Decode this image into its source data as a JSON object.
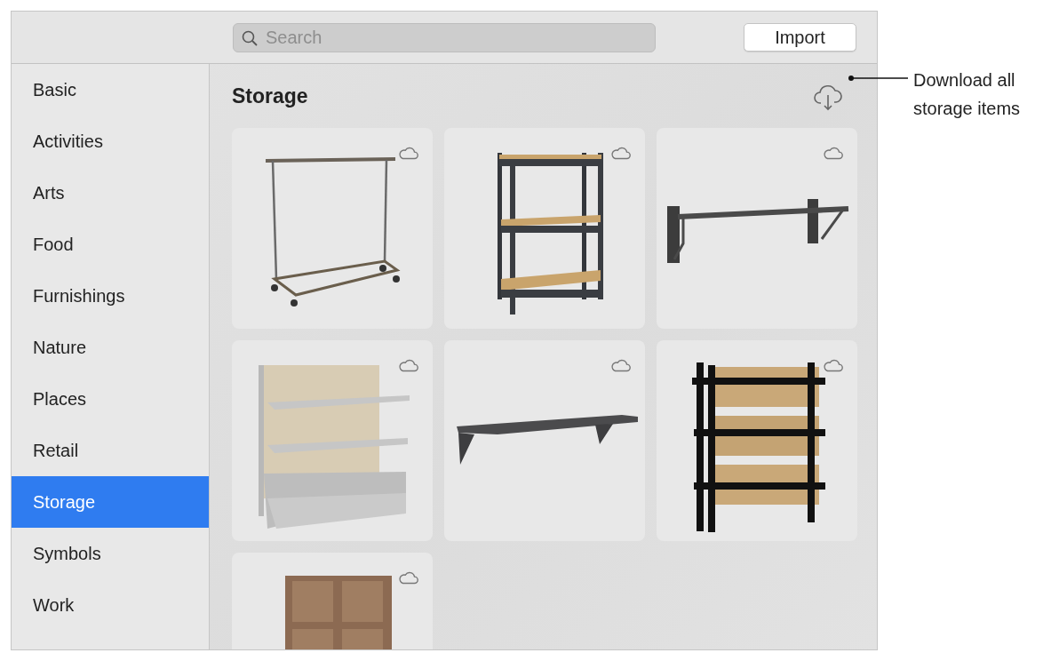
{
  "toolbar": {
    "search": {
      "placeholder": "Search"
    },
    "import_button": "Import"
  },
  "sidebar": {
    "items": [
      {
        "label": "Basic",
        "selected": false
      },
      {
        "label": "Activities",
        "selected": false
      },
      {
        "label": "Arts",
        "selected": false
      },
      {
        "label": "Food",
        "selected": false
      },
      {
        "label": "Furnishings",
        "selected": false
      },
      {
        "label": "Nature",
        "selected": false
      },
      {
        "label": "Places",
        "selected": false
      },
      {
        "label": "Retail",
        "selected": false
      },
      {
        "label": "Storage",
        "selected": true
      },
      {
        "label": "Symbols",
        "selected": false
      },
      {
        "label": "Work",
        "selected": false
      }
    ]
  },
  "content": {
    "title": "Storage",
    "items": [
      {
        "kind": "clothes-rack",
        "downloaded": false
      },
      {
        "kind": "metal-shelf",
        "downloaded": false
      },
      {
        "kind": "wall-rail",
        "downloaded": false
      },
      {
        "kind": "gondola-shelf",
        "downloaded": false
      },
      {
        "kind": "wall-shelf",
        "downloaded": false
      },
      {
        "kind": "bin-rack",
        "downloaded": false
      },
      {
        "kind": "cubby-shelf",
        "downloaded": false
      }
    ]
  },
  "callout": {
    "text": "Download all storage items"
  }
}
